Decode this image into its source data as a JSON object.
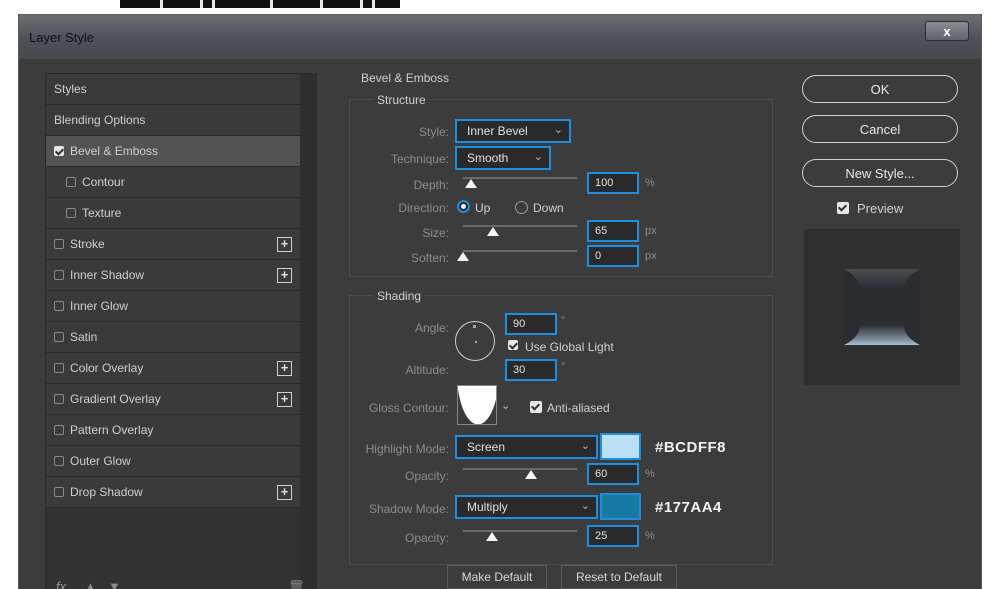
{
  "window": {
    "title": "Layer Style",
    "close_label": "x"
  },
  "styles_list": {
    "items": [
      {
        "label": "Styles",
        "checkbox": null,
        "plus": false,
        "selected": false,
        "indent": 0
      },
      {
        "label": "Blending Options",
        "checkbox": null,
        "plus": false,
        "selected": false,
        "indent": 0
      },
      {
        "label": "Bevel & Emboss",
        "checkbox": true,
        "plus": false,
        "selected": true,
        "indent": 0
      },
      {
        "label": "Contour",
        "checkbox": false,
        "plus": false,
        "selected": false,
        "indent": 1
      },
      {
        "label": "Texture",
        "checkbox": false,
        "plus": false,
        "selected": false,
        "indent": 1
      },
      {
        "label": "Stroke",
        "checkbox": false,
        "plus": true,
        "selected": false,
        "indent": 0
      },
      {
        "label": "Inner Shadow",
        "checkbox": false,
        "plus": true,
        "selected": false,
        "indent": 0
      },
      {
        "label": "Inner Glow",
        "checkbox": false,
        "plus": false,
        "selected": false,
        "indent": 0
      },
      {
        "label": "Satin",
        "checkbox": false,
        "plus": false,
        "selected": false,
        "indent": 0
      },
      {
        "label": "Color Overlay",
        "checkbox": false,
        "plus": true,
        "selected": false,
        "indent": 0
      },
      {
        "label": "Gradient Overlay",
        "checkbox": false,
        "plus": true,
        "selected": false,
        "indent": 0
      },
      {
        "label": "Pattern Overlay",
        "checkbox": false,
        "plus": false,
        "selected": false,
        "indent": 0
      },
      {
        "label": "Outer Glow",
        "checkbox": false,
        "plus": false,
        "selected": false,
        "indent": 0
      },
      {
        "label": "Drop Shadow",
        "checkbox": false,
        "plus": true,
        "selected": false,
        "indent": 0
      }
    ],
    "footer": {
      "fx_label": "fx"
    }
  },
  "bevel": {
    "section_title": "Bevel & Emboss",
    "structure_title": "Structure",
    "style_label": "Style:",
    "style_value": "Inner Bevel",
    "technique_label": "Technique:",
    "technique_value": "Smooth",
    "depth_label": "Depth:",
    "depth_value": "100",
    "depth_unit": "%",
    "direction_label": "Direction:",
    "direction_up": "Up",
    "direction_down": "Down",
    "size_label": "Size:",
    "size_value": "65",
    "size_unit": "px",
    "soften_label": "Soften:",
    "soften_value": "0",
    "soften_unit": "px"
  },
  "shading": {
    "title": "Shading",
    "angle_label": "Angle:",
    "angle_value": "90",
    "angle_unit": "°",
    "global_light_label": "Use Global Light",
    "altitude_label": "Altitude:",
    "altitude_value": "30",
    "altitude_unit": "°",
    "gloss_label": "Gloss Contour:",
    "antialiased_label": "Anti-aliased",
    "highlight_mode_label": "Highlight Mode:",
    "highlight_mode_value": "Screen",
    "highlight_color": "#BCDFF8",
    "highlight_hex": "#BCDFF8",
    "highlight_opacity_label": "Opacity:",
    "highlight_opacity_value": "60",
    "highlight_opacity_unit": "%",
    "shadow_mode_label": "Shadow Mode:",
    "shadow_mode_value": "Multiply",
    "shadow_color": "#177AA4",
    "shadow_hex": "#177AA4",
    "shadow_opacity_label": "Opacity:",
    "shadow_opacity_value": "25",
    "shadow_opacity_unit": "%"
  },
  "buttons": {
    "make_default": "Make Default",
    "reset_default": "Reset to Default",
    "ok": "OK",
    "cancel": "Cancel",
    "new_style": "New Style...",
    "preview_label": "Preview"
  },
  "sliders": {
    "depth": 0.07,
    "size": 0.26,
    "soften": 0.0,
    "highlight_opacity": 0.6,
    "shadow_opacity": 0.25
  },
  "colors": {
    "accent": "#1D8FE0"
  }
}
